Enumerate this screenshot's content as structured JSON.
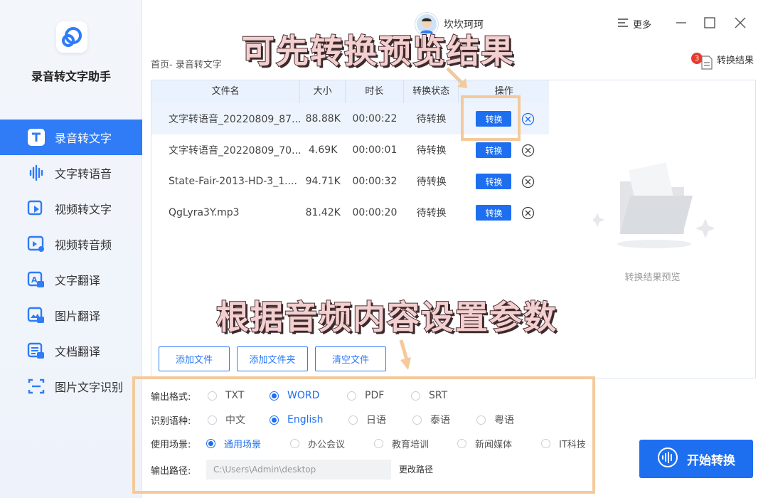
{
  "app": {
    "name": "录音转文字助手"
  },
  "sidebar": {
    "items": [
      {
        "label": "录音转文字",
        "icon": "text-t-icon",
        "active": true
      },
      {
        "label": "文字转语音",
        "icon": "sound-wave-icon"
      },
      {
        "label": "视频转文字",
        "icon": "video-play-icon"
      },
      {
        "label": "视频转音频",
        "icon": "video-audio-icon"
      },
      {
        "label": "文字翻译",
        "icon": "text-translate-icon"
      },
      {
        "label": "图片翻译",
        "icon": "image-translate-icon"
      },
      {
        "label": "文档翻译",
        "icon": "document-translate-icon"
      },
      {
        "label": "图片文字识别",
        "icon": "scan-ocr-icon"
      }
    ]
  },
  "topbar": {
    "username": "坎坎珂珂",
    "more_label": "更多"
  },
  "breadcrumb": "首页- 录音转文字",
  "results": {
    "badge_count": "3",
    "label": "转换结果"
  },
  "table": {
    "headers": [
      "文件名",
      "大小",
      "时长",
      "转换状态",
      "操作"
    ],
    "rows": [
      {
        "name": "文字转语音_20220809_87...",
        "size": "88.88K",
        "duration": "00:00:22",
        "status": "待转换",
        "action": "转换"
      },
      {
        "name": "文字转语音_20220809_70...",
        "size": "4.69K",
        "duration": "00:00:01",
        "status": "待转换",
        "action": "转换"
      },
      {
        "name": "State-Fair-2013-HD-3_1....",
        "size": "94.71K",
        "duration": "00:00:32",
        "status": "待转换",
        "action": "转换"
      },
      {
        "name": "QgLyra3Y.mp3",
        "size": "81.42K",
        "duration": "00:00:20",
        "status": "待转换",
        "action": "转换"
      }
    ]
  },
  "buttons": {
    "add_file": "添加文件",
    "add_folder": "添加文件夹",
    "clear_files": "清空文件"
  },
  "preview": {
    "label": "转换结果预览"
  },
  "settings": {
    "output_format": {
      "label": "输出格式:",
      "options": [
        "TXT",
        "WORD",
        "PDF",
        "SRT"
      ],
      "selected": "WORD"
    },
    "language": {
      "label": "识别语种:",
      "options": [
        "中文",
        "English",
        "日语",
        "泰语",
        "粤语"
      ],
      "selected": "English"
    },
    "scene": {
      "label": "使用场景:",
      "options": [
        "通用场景",
        "办公会议",
        "教育培训",
        "新闻媒体",
        "IT科技"
      ],
      "selected": "通用场景"
    },
    "output_path": {
      "label": "输出路径:",
      "value": "C:\\Users\\Admin\\desktop",
      "change_label": "更改路径"
    }
  },
  "start_button": {
    "label": "开始转换"
  },
  "annotations": {
    "top": "可先转换预览结果",
    "bottom": "根据音频内容设置参数"
  },
  "colors": {
    "accent": "#1e6ff0",
    "highlight_box": "#f4c99b",
    "badge": "#e63b2e"
  }
}
